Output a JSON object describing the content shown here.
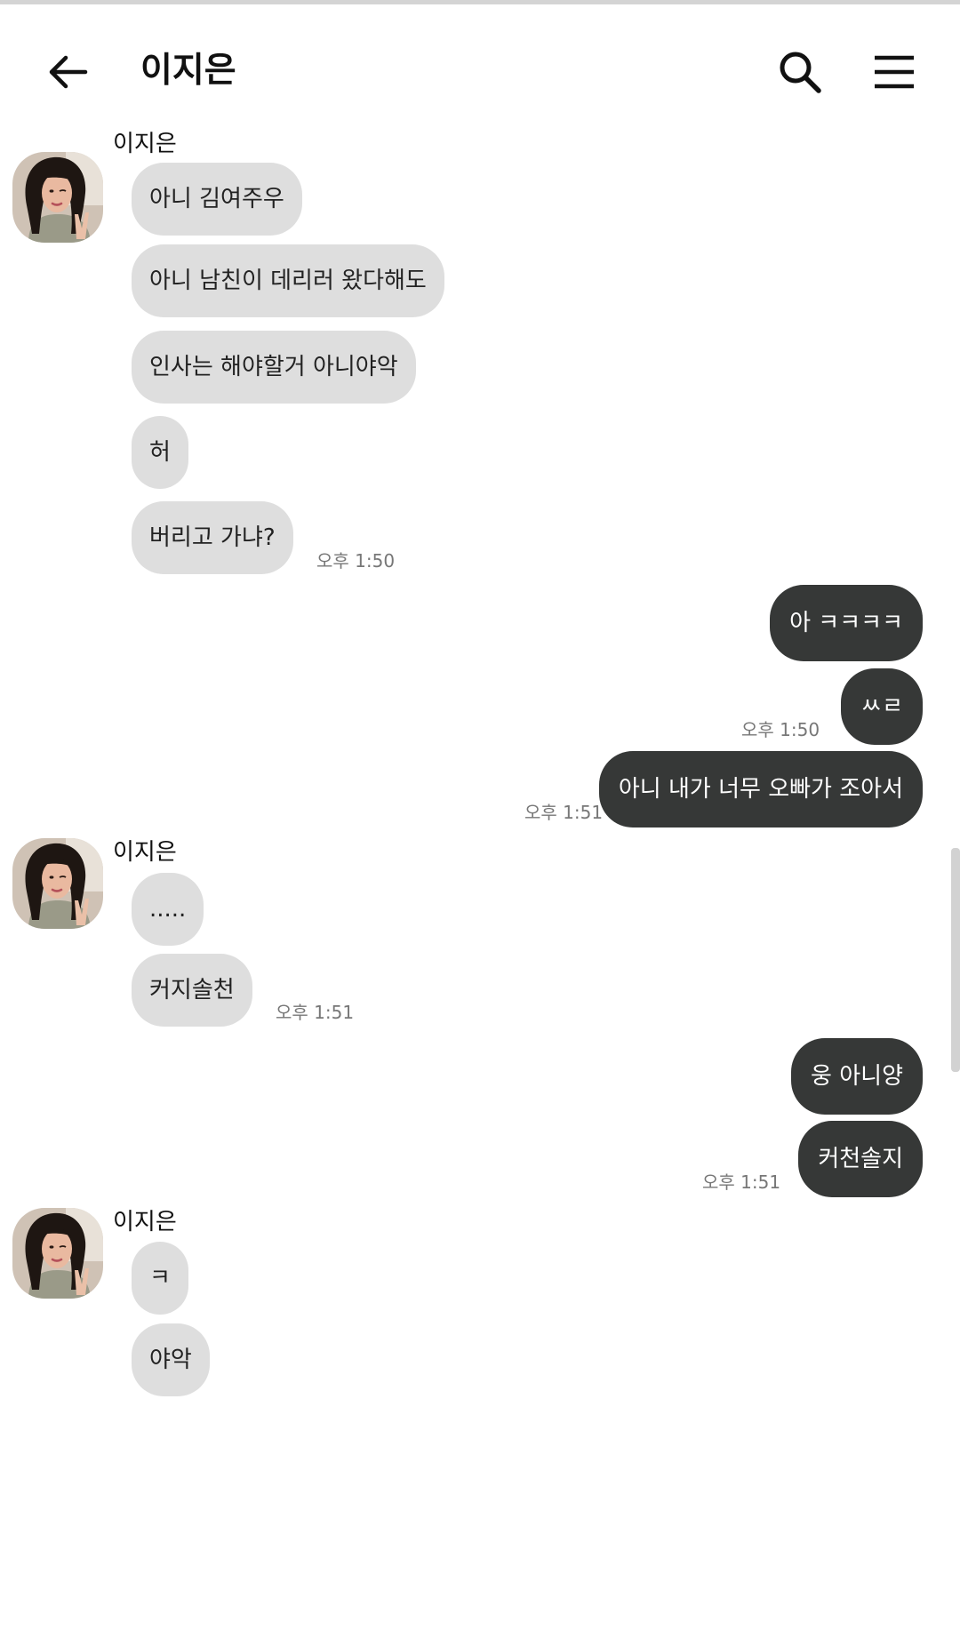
{
  "header": {
    "title": "이지은",
    "back_icon": "arrow-left-icon",
    "search_icon": "search-icon",
    "menu_icon": "hamburger-menu-icon"
  },
  "colors": {
    "incoming_bubble": "#dedede",
    "outgoing_bubble": "#363837",
    "timestamp": "#777777"
  },
  "messages": {
    "group1": {
      "sender": "이지은",
      "m1": "아니 김여주우",
      "m2": "아니 남친이 데리러 왔다해도",
      "m3": "인사는 해야할거 아니야악",
      "m4": "허",
      "m5": "버리고 가냐?",
      "time": "오후 1:50"
    },
    "group2": {
      "m1": "아 ㅋㅋㅋㅋ",
      "m2": "ㅆㄹ",
      "time": "오후 1:50"
    },
    "group3": {
      "m1": "아니 내가 너무 오빠가 조아서",
      "time": "오후 1:51"
    },
    "group4": {
      "sender": "이지은",
      "m1": ".....",
      "m2": "커지솔천",
      "time": "오후 1:51"
    },
    "group5": {
      "m1": "웅 아니양",
      "m2": "커천솔지",
      "time": "오후 1:51"
    },
    "group6": {
      "sender": "이지은",
      "m1": "ㅋ",
      "m2": "야악"
    }
  }
}
